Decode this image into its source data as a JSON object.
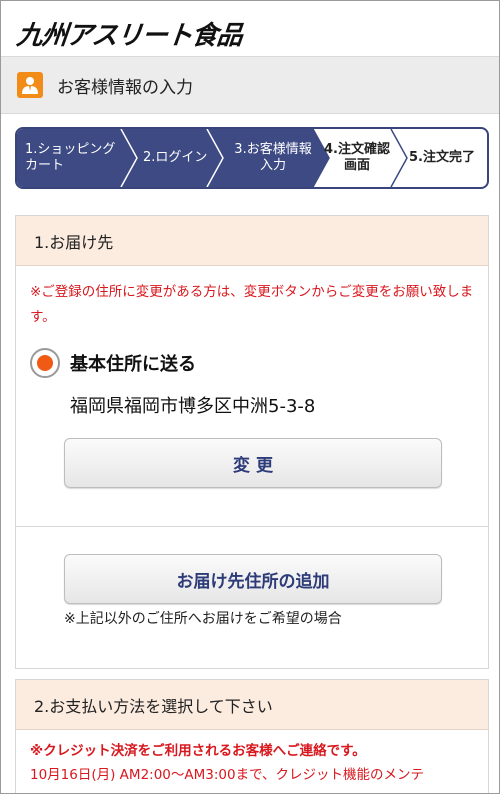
{
  "header": {
    "logo_text": "九州アスリート食品"
  },
  "title_bar": {
    "icon": "person-icon",
    "title": "お客様情報の入力"
  },
  "steps": [
    {
      "line1": "1.ショッピング",
      "line2": "カート",
      "state": "done"
    },
    {
      "line1": "2.ログイン",
      "line2": "",
      "state": "done"
    },
    {
      "line1": "3.お客様情報",
      "line2": "入力",
      "state": "current"
    },
    {
      "line1": "4.注文確認",
      "line2": "画面",
      "state": "todo"
    },
    {
      "line1": "5.注文完了",
      "line2": "",
      "state": "todo"
    }
  ],
  "colors": {
    "step_active": "#3d4a83",
    "step_inactive": "#ffffff",
    "accent_orange": "#f05a14",
    "notice_red": "#d8181e",
    "section_header_bg": "#fcebdf",
    "button_text": "#2d3b78"
  },
  "delivery": {
    "heading": "1.お届け先",
    "notice": "※ご登録の住所に変更がある方は、変更ボタンからご変更をお願い致します。",
    "option_label": "基本住所に送る",
    "option_selected": true,
    "address": "福岡県福岡市博多区中洲5-3-8",
    "change_button": "変 更",
    "add_button": "お届け先住所の追加",
    "add_note": "※上記以外のご住所へお届けをご希望の場合"
  },
  "payment": {
    "heading": "2.お支払い方法を選択して下さい",
    "notice_bold": "※クレジット決済をご利用されるお客様へご連絡です。",
    "notice_line": "10月16日(月) AM2:00〜AM3:00まで、クレジット機能のメンテ"
  }
}
